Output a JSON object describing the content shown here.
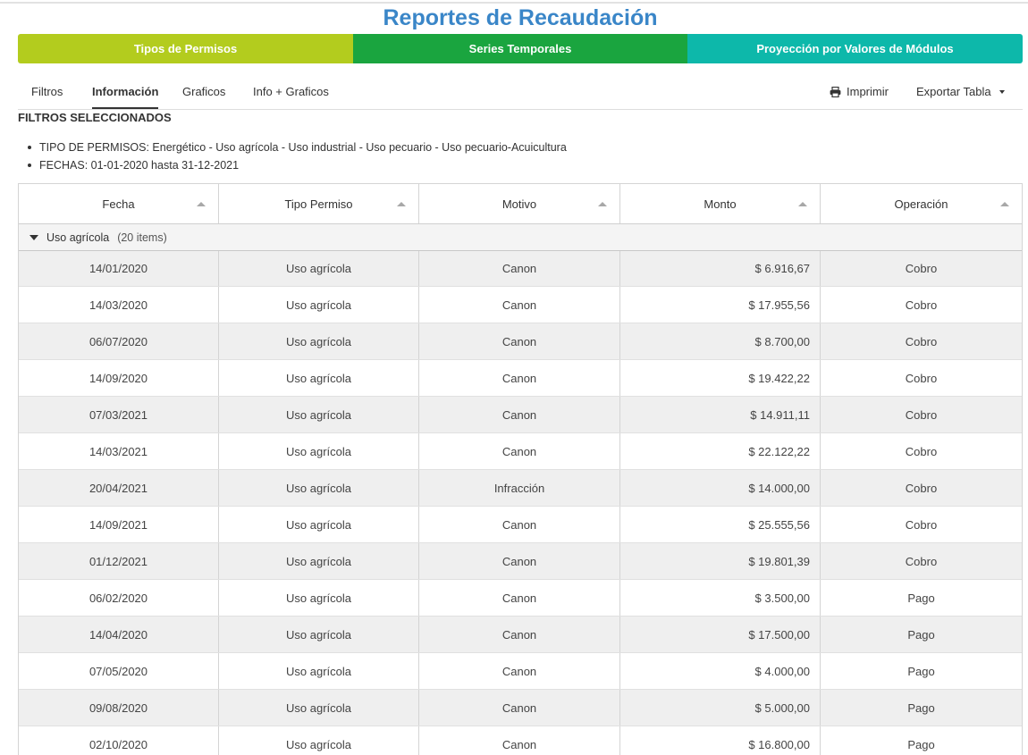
{
  "page": {
    "title": "Reportes de Recaudación"
  },
  "bands": [
    {
      "label": "Tipos de Permisos",
      "color": "#b3cc1e"
    },
    {
      "label": "Series Temporales",
      "color": "#1aa53f"
    },
    {
      "label": "Proyección por Valores de Módulos",
      "color": "#0db8aa"
    }
  ],
  "tabs": [
    {
      "label": "Filtros",
      "active": false
    },
    {
      "label": "Información",
      "active": true
    },
    {
      "label": "Graficos",
      "active": false
    },
    {
      "label": "Info + Graficos",
      "active": false
    }
  ],
  "actions": {
    "print_label": "Imprimir",
    "print_icon": "printer-icon",
    "export_label": "Exportar Tabla",
    "export_icon": "caret-down-icon"
  },
  "filters": {
    "title": "FILTROS SELECCIONADOS",
    "items": [
      "TIPO DE PERMISOS: Energético - Uso agrícola - Uso industrial - Uso pecuario - Uso pecuario-Acuicultura",
      "FECHAS: 01-01-2020 hasta 31-12-2021"
    ]
  },
  "table": {
    "columns": [
      "Fecha",
      "Tipo Permiso",
      "Motivo",
      "Monto",
      "Operación"
    ],
    "group": {
      "name": "Uso agrícola",
      "count_text": "(20 items)"
    },
    "rows": [
      [
        "14/01/2020",
        "Uso agrícola",
        "Canon",
        "$ 6.916,67",
        "Cobro"
      ],
      [
        "14/03/2020",
        "Uso agrícola",
        "Canon",
        "$ 17.955,56",
        "Cobro"
      ],
      [
        "06/07/2020",
        "Uso agrícola",
        "Canon",
        "$ 8.700,00",
        "Cobro"
      ],
      [
        "14/09/2020",
        "Uso agrícola",
        "Canon",
        "$ 19.422,22",
        "Cobro"
      ],
      [
        "07/03/2021",
        "Uso agrícola",
        "Canon",
        "$ 14.911,11",
        "Cobro"
      ],
      [
        "14/03/2021",
        "Uso agrícola",
        "Canon",
        "$ 22.122,22",
        "Cobro"
      ],
      [
        "20/04/2021",
        "Uso agrícola",
        "Infracción",
        "$ 14.000,00",
        "Cobro"
      ],
      [
        "14/09/2021",
        "Uso agrícola",
        "Canon",
        "$ 25.555,56",
        "Cobro"
      ],
      [
        "01/12/2021",
        "Uso agrícola",
        "Canon",
        "$ 19.801,39",
        "Cobro"
      ],
      [
        "06/02/2020",
        "Uso agrícola",
        "Canon",
        "$ 3.500,00",
        "Pago"
      ],
      [
        "14/04/2020",
        "Uso agrícola",
        "Canon",
        "$ 17.500,00",
        "Pago"
      ],
      [
        "07/05/2020",
        "Uso agrícola",
        "Canon",
        "$ 4.000,00",
        "Pago"
      ],
      [
        "09/08/2020",
        "Uso agrícola",
        "Canon",
        "$ 5.000,00",
        "Pago"
      ],
      [
        "02/10/2020",
        "Uso agrícola",
        "Canon",
        "$ 16.800,00",
        "Pago"
      ]
    ]
  }
}
